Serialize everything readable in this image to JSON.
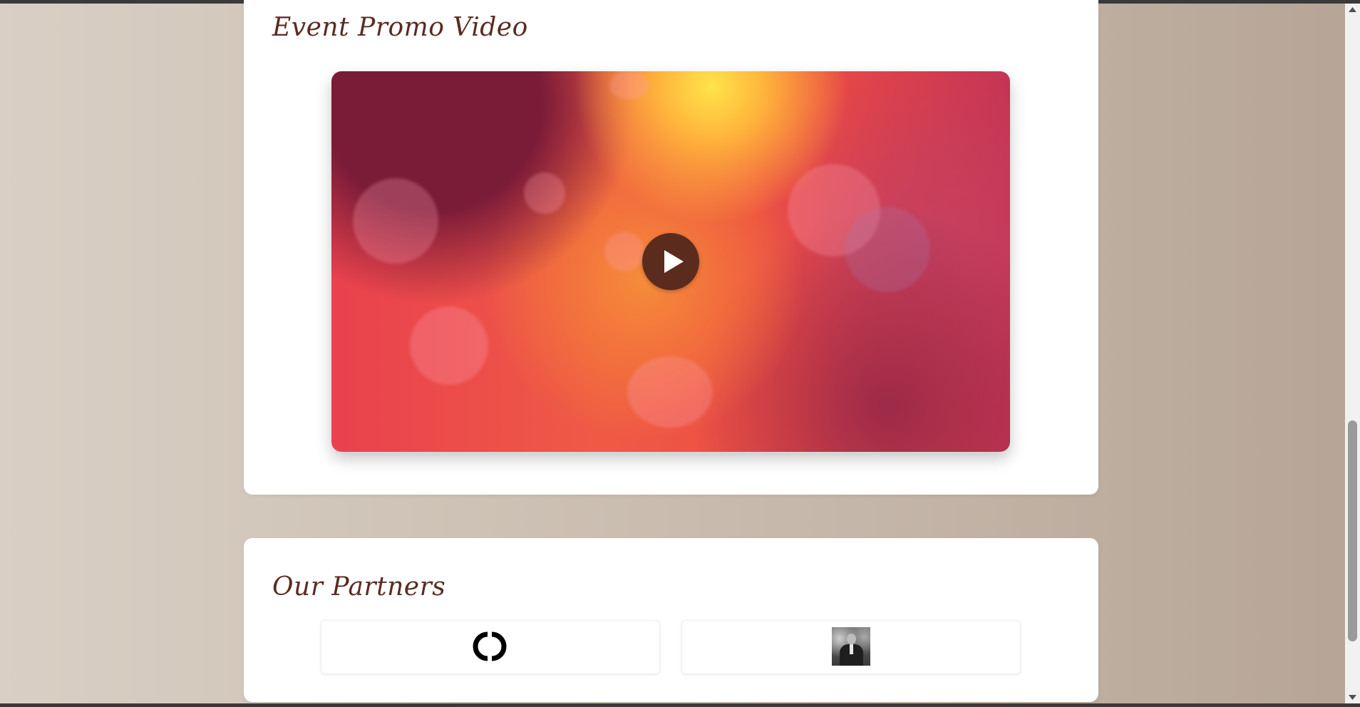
{
  "promo": {
    "title": "Event Promo Video",
    "play_icon": "play-icon"
  },
  "partners": {
    "title": "Our Partners",
    "items": [
      {
        "logo": "chanel-logo"
      },
      {
        "logo": "speaker-photo"
      }
    ]
  },
  "colors": {
    "heading": "#5a2b22",
    "play_button": "#5b2c1d",
    "page_bg_start": "#d9cfc4",
    "page_bg_end": "#b6a597"
  },
  "scrollbar": {
    "scroll_position": 0.9
  }
}
